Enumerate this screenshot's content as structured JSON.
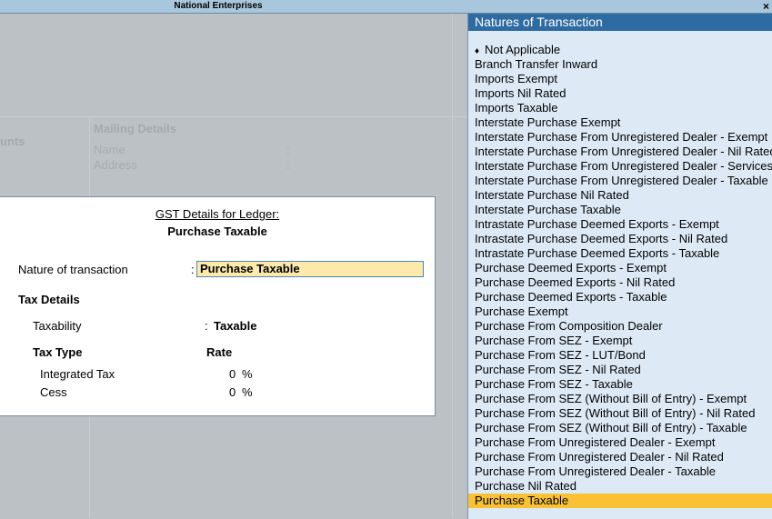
{
  "window": {
    "title": "National Enterprises",
    "close_glyph": "×"
  },
  "background": {
    "partial_heading": "unts",
    "mailing_heading": "Mailing Details",
    "name_label": "Name",
    "address_label": "Address",
    "colon": ":"
  },
  "dialog": {
    "heading": "GST Details for Ledger:",
    "ledger_name": "Purchase Taxable",
    "nature_label": "Nature of transaction",
    "nature_value": "Purchase Taxable",
    "tax_details_label": "Tax Details",
    "taxability_label": "Taxability",
    "taxability_value": "Taxable",
    "tax_type_header": "Tax Type",
    "rate_header": "Rate",
    "rows": [
      {
        "name": "Integrated Tax",
        "rate": "0",
        "unit": "%"
      },
      {
        "name": "Cess",
        "rate": "0",
        "unit": "%"
      }
    ],
    "colon": ":"
  },
  "panel": {
    "title": "Natures of Transaction",
    "bullet_glyph": "♦",
    "selected_index": 31,
    "items": [
      "Not Applicable",
      "Branch Transfer Inward",
      "Imports Exempt",
      "Imports Nil Rated",
      "Imports Taxable",
      "Interstate Purchase Exempt",
      "Interstate Purchase From Unregistered Dealer - Exempt",
      "Interstate Purchase From Unregistered Dealer - Nil Rated",
      "Interstate Purchase From Unregistered Dealer - Services",
      "Interstate Purchase From Unregistered Dealer - Taxable",
      "Interstate Purchase Nil Rated",
      "Interstate Purchase Taxable",
      "Intrastate Purchase Deemed Exports - Exempt",
      "Intrastate Purchase Deemed Exports - Nil Rated",
      "Intrastate Purchase Deemed Exports - Taxable",
      "Purchase Deemed Exports - Exempt",
      "Purchase Deemed Exports - Nil Rated",
      "Purchase Deemed Exports - Taxable",
      "Purchase Exempt",
      "Purchase From Composition Dealer",
      "Purchase From SEZ - Exempt",
      "Purchase From SEZ - LUT/Bond",
      "Purchase From SEZ - Nil Rated",
      "Purchase From SEZ - Taxable",
      "Purchase From SEZ (Without Bill of Entry) - Exempt",
      "Purchase From SEZ (Without Bill of Entry) - Nil Rated",
      "Purchase From SEZ (Without Bill of Entry) - Taxable",
      "Purchase From Unregistered Dealer - Exempt",
      "Purchase From Unregistered Dealer - Nil Rated",
      "Purchase From Unregistered Dealer - Taxable",
      "Purchase Nil Rated",
      "Purchase Taxable"
    ]
  }
}
